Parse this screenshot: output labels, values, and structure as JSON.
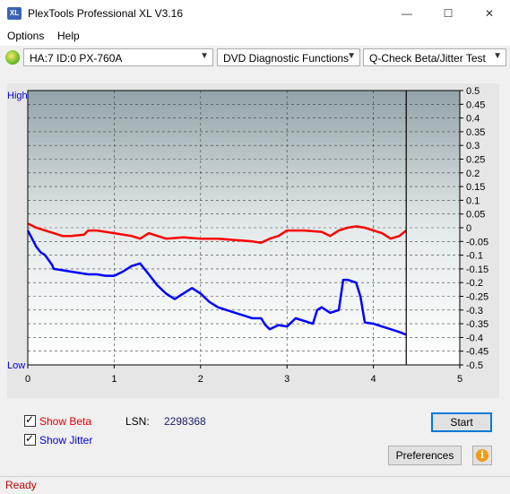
{
  "window": {
    "title": "PlexTools Professional XL V3.16",
    "icon_text": "XL",
    "min_glyph": "—",
    "max_glyph": "☐",
    "close_glyph": "✕"
  },
  "menu": {
    "options": "Options",
    "help": "Help"
  },
  "toolbar": {
    "drive": "HA:7 ID:0  PX-760A",
    "function": "DVD Diagnostic Functions",
    "test": "Q-Check Beta/Jitter Test"
  },
  "chart_data": {
    "type": "line",
    "x_ticks": [
      "0",
      "1",
      "2",
      "3",
      "4",
      "5"
    ],
    "xlim": [
      0,
      5
    ],
    "y_left_labels": [
      "High",
      "Low"
    ],
    "y_right_ticks": [
      "0.5",
      "0.45",
      "0.4",
      "0.35",
      "0.3",
      "0.25",
      "0.2",
      "0.15",
      "0.1",
      "0.05",
      "0",
      "-0.05",
      "-0.1",
      "-0.15",
      "-0.2",
      "-0.25",
      "-0.3",
      "-0.35",
      "-0.4",
      "-0.45",
      "-0.5"
    ],
    "ylim": [
      -0.5,
      0.5
    ],
    "end_marker_x": 4.38,
    "grid": true,
    "series": [
      {
        "name": "Beta",
        "color": "#ff0000",
        "x": [
          0,
          0.1,
          0.2,
          0.3,
          0.4,
          0.5,
          0.65,
          0.7,
          0.8,
          1.0,
          1.2,
          1.3,
          1.4,
          1.5,
          1.6,
          1.8,
          2.0,
          2.2,
          2.4,
          2.6,
          2.7,
          2.8,
          2.9,
          3.0,
          3.2,
          3.4,
          3.5,
          3.6,
          3.7,
          3.8,
          3.9,
          4.0,
          4.1,
          4.2,
          4.3,
          4.38
        ],
        "values": [
          0.015,
          0.0,
          -0.01,
          -0.02,
          -0.03,
          -0.03,
          -0.025,
          -0.01,
          -0.01,
          -0.02,
          -0.03,
          -0.04,
          -0.02,
          -0.03,
          -0.04,
          -0.035,
          -0.04,
          -0.04,
          -0.045,
          -0.05,
          -0.055,
          -0.04,
          -0.03,
          -0.01,
          -0.01,
          -0.015,
          -0.03,
          -0.01,
          0.0,
          0.005,
          0.0,
          -0.01,
          -0.02,
          -0.04,
          -0.03,
          -0.01
        ]
      },
      {
        "name": "Jitter",
        "color": "#0000ff",
        "x": [
          0,
          0.05,
          0.1,
          0.15,
          0.2,
          0.28,
          0.3,
          0.4,
          0.5,
          0.6,
          0.7,
          0.8,
          0.9,
          1.0,
          1.1,
          1.2,
          1.3,
          1.4,
          1.5,
          1.6,
          1.7,
          1.8,
          1.9,
          2.0,
          2.1,
          2.2,
          2.3,
          2.4,
          2.5,
          2.6,
          2.7,
          2.75,
          2.8,
          2.9,
          3.0,
          3.1,
          3.2,
          3.3,
          3.35,
          3.4,
          3.5,
          3.6,
          3.65,
          3.7,
          3.8,
          3.85,
          3.9,
          4.0,
          4.1,
          4.2,
          4.3,
          4.38
        ],
        "values": [
          -0.01,
          -0.04,
          -0.07,
          -0.09,
          -0.1,
          -0.135,
          -0.15,
          -0.155,
          -0.16,
          -0.165,
          -0.17,
          -0.17,
          -0.175,
          -0.175,
          -0.16,
          -0.14,
          -0.13,
          -0.17,
          -0.21,
          -0.24,
          -0.26,
          -0.24,
          -0.22,
          -0.24,
          -0.27,
          -0.29,
          -0.3,
          -0.31,
          -0.32,
          -0.33,
          -0.33,
          -0.355,
          -0.37,
          -0.355,
          -0.36,
          -0.33,
          -0.34,
          -0.35,
          -0.3,
          -0.29,
          -0.31,
          -0.3,
          -0.19,
          -0.19,
          -0.2,
          -0.25,
          -0.345,
          -0.35,
          -0.36,
          -0.37,
          -0.38,
          -0.39
        ]
      }
    ]
  },
  "controls": {
    "show_beta": "Show Beta",
    "show_jitter": "Show Jitter",
    "lsn_label": "LSN:",
    "lsn_value": "2298368",
    "start": "Start",
    "preferences": "Preferences",
    "info_glyph": "i"
  },
  "status": {
    "text": "Ready"
  }
}
